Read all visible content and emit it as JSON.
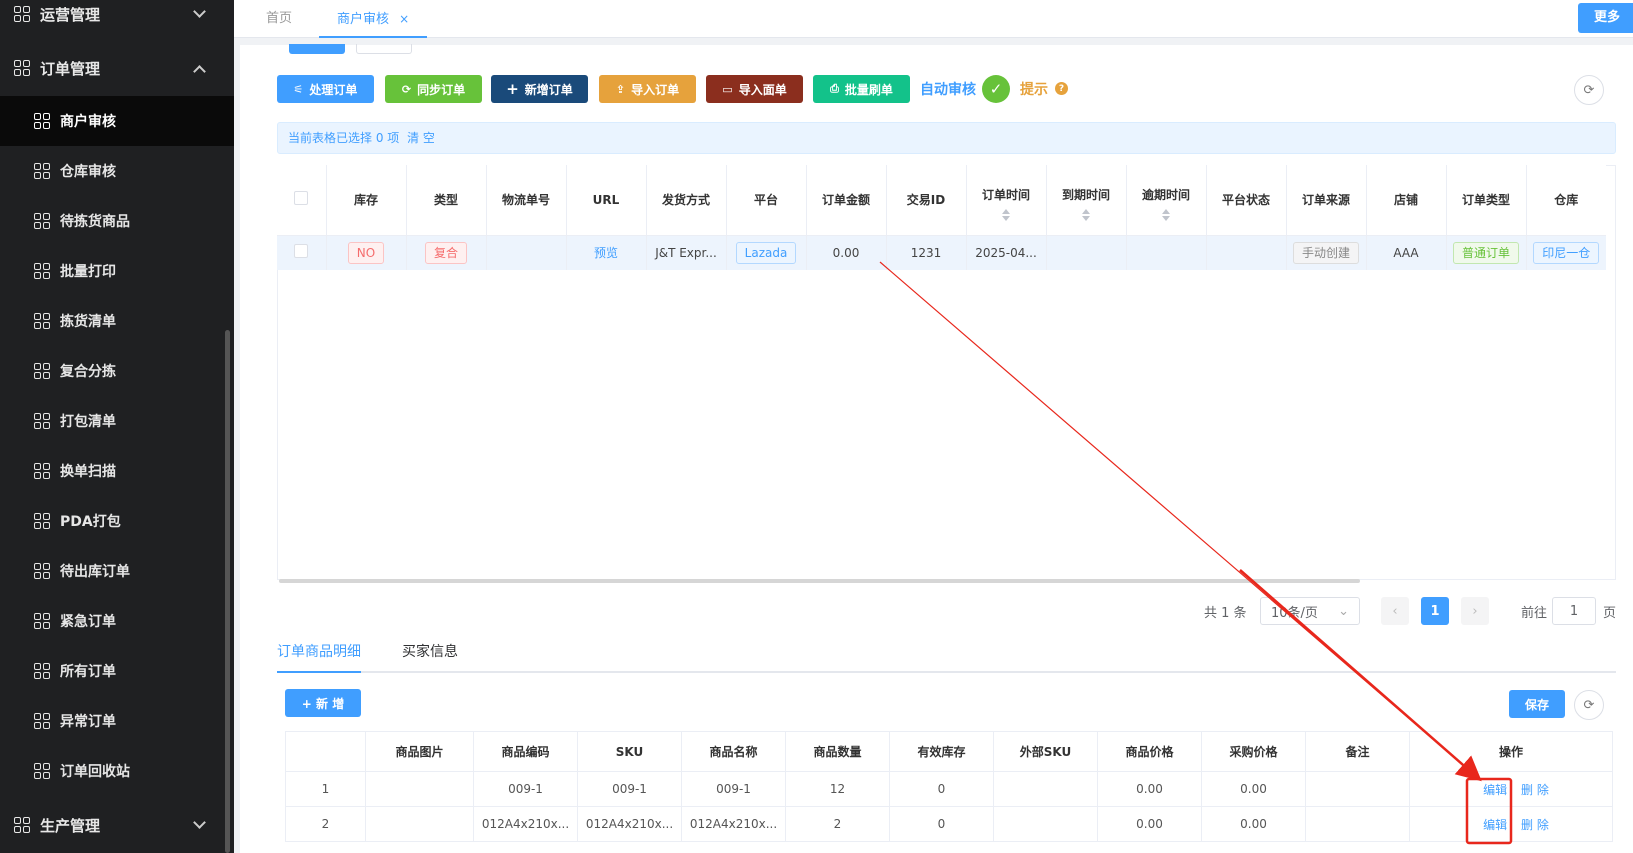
{
  "sidebar": {
    "groups": [
      {
        "label": "运营管理"
      },
      {
        "label": "订单管理"
      },
      {
        "label": "生产管理"
      }
    ],
    "items": [
      {
        "label": "商户审核"
      },
      {
        "label": "仓库审核"
      },
      {
        "label": "待拣货商品"
      },
      {
        "label": "批量打印"
      },
      {
        "label": "拣货清单"
      },
      {
        "label": "复合分拣"
      },
      {
        "label": "打包清单"
      },
      {
        "label": "换单扫描"
      },
      {
        "label": "PDA打包"
      },
      {
        "label": "待出库订单"
      },
      {
        "label": "紧急订单"
      },
      {
        "label": "所有订单"
      },
      {
        "label": "异常订单"
      },
      {
        "label": "订单回收站"
      }
    ]
  },
  "tabs": {
    "home": "首页",
    "current": "商户审核",
    "close": "×",
    "more": "更多"
  },
  "toolbar": {
    "process": "处理订单",
    "sync": "同步订单",
    "add": "新增订单",
    "import_order": "导入订单",
    "import_sheet": "导入面单",
    "batch_refresh": "批量刷单",
    "auto_review": "自动审核",
    "hint": "提示",
    "hint_icon": "?",
    "check_icon": "✓",
    "refresh_icon": "⟳"
  },
  "selection_bar": {
    "text": "当前表格已选择 0 项",
    "clear": "清 空"
  },
  "order_table": {
    "headers": [
      "库存",
      "类型",
      "物流单号",
      "URL",
      "发货方式",
      "平台",
      "订单金额",
      "交易ID",
      "订单时间",
      "到期时间",
      "逾期时间",
      "平台状态",
      "订单来源",
      "店铺",
      "订单类型",
      "仓库"
    ],
    "row": {
      "stock": "NO",
      "type": "复合",
      "tracking": "",
      "url": "预览",
      "shipping": "J&T Expr...",
      "platform": "Lazada",
      "amount": "0.00",
      "trade_id": "1231",
      "order_time": "2025-04...",
      "due_time": "",
      "overdue_time": "",
      "platform_status": "",
      "source": "手动创建",
      "shop": "AAA",
      "order_type": "普通订单",
      "warehouse": "印尼一仓"
    }
  },
  "pagination": {
    "total": "共 1 条",
    "page_size": "10条/页",
    "current_page": "1",
    "goto_label": "前往",
    "goto_value": "1",
    "page_unit": "页",
    "prev": "‹",
    "next": "›",
    "size_arrow": "⌄"
  },
  "detail_tabs": {
    "items": "订单商品明细",
    "buyer": "买家信息"
  },
  "detail_toolbar": {
    "add": "+ 新 增",
    "save": "保存",
    "refresh_icon": "⟳"
  },
  "items_table": {
    "headers": [
      "",
      "商品图片",
      "商品编码",
      "SKU",
      "商品名称",
      "商品数量",
      "有效库存",
      "外部SKU",
      "商品价格",
      "采购价格",
      "备注",
      "操作"
    ],
    "rows": [
      {
        "index": "1",
        "image": "",
        "code": "009-1",
        "sku": "009-1",
        "name": "009-1",
        "qty": "12",
        "stock": "0",
        "ext_sku": "",
        "price": "0.00",
        "purchase": "0.00",
        "remark": "",
        "edit": "编辑",
        "delete": "删 除"
      },
      {
        "index": "2",
        "image": "",
        "code": "012A4x210x...",
        "sku": "012A4x210x...",
        "name": "012A4x210x...",
        "qty": "2",
        "stock": "0",
        "ext_sku": "",
        "price": "0.00",
        "purchase": "0.00",
        "remark": "",
        "edit": "编辑",
        "delete": "删 除"
      }
    ]
  },
  "colors": {
    "primary": "#409eff",
    "green": "#67c23a",
    "navy": "#1a4a7a",
    "orange": "#e6a23c",
    "brown": "#8b2e1e",
    "teal": "#13c28a",
    "annotation": "#e8271c"
  }
}
